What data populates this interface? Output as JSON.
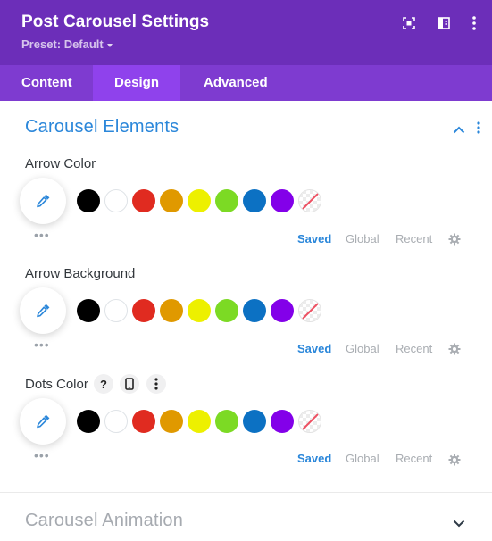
{
  "header": {
    "title": "Post Carousel Settings",
    "preset_label": "Preset: Default",
    "icons": [
      "expand-icon",
      "split-view-icon",
      "more-options-icon"
    ]
  },
  "tabs": [
    {
      "label": "Content",
      "active": false
    },
    {
      "label": "Design",
      "active": true
    },
    {
      "label": "Advanced",
      "active": false
    }
  ],
  "sections": {
    "carousel_elements": {
      "title": "Carousel Elements",
      "expanded": true
    },
    "carousel_animation": {
      "title": "Carousel Animation",
      "expanded": false
    }
  },
  "fields": [
    {
      "label": "Arrow Color"
    },
    {
      "label": "Arrow Background"
    },
    {
      "label": "Dots Color"
    }
  ],
  "palette": {
    "colors": [
      "#000000",
      "#ffffff",
      "#e02b20",
      "#e09900",
      "#edf000",
      "#7cda24",
      "#0c71c3",
      "#8300e9"
    ],
    "includes_none_swatch": true,
    "tabs": {
      "saved": "Saved",
      "global": "Global",
      "recent": "Recent"
    },
    "active_tab": "Saved",
    "more_dots": "•••"
  },
  "dots_color_icons": {
    "help": "?"
  },
  "accent": {
    "header_bg": "#6c2eb9",
    "tabs_bg": "#7e3bd0",
    "active_tab_bg": "#8f42ec",
    "link_blue": "#2b87da"
  }
}
